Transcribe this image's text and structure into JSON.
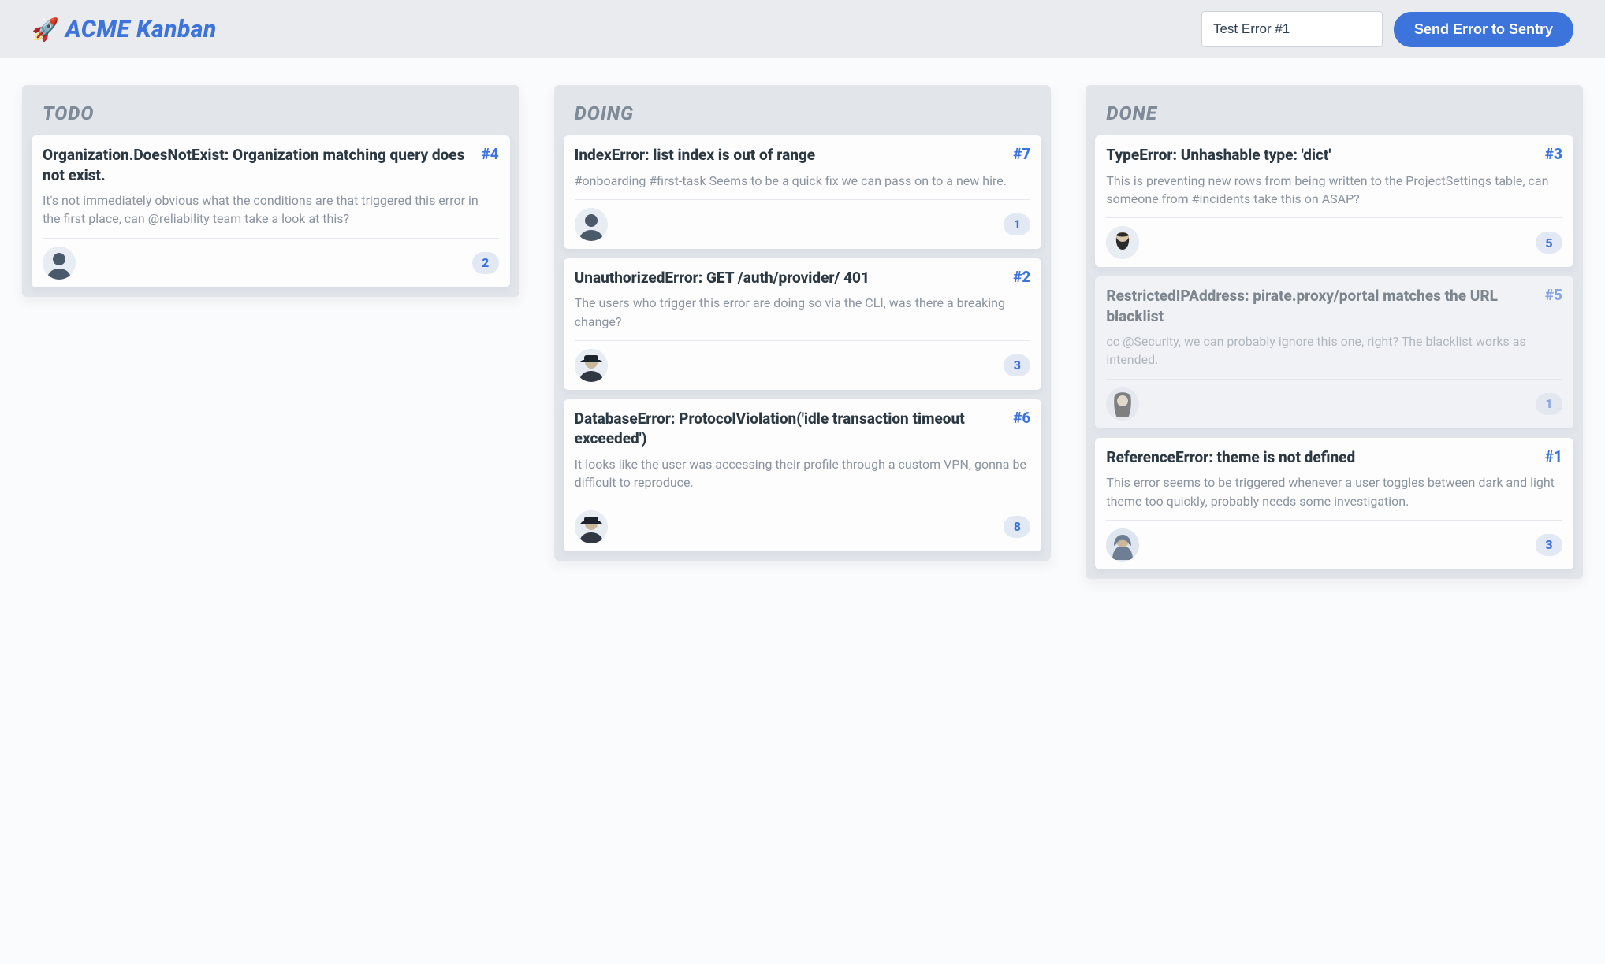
{
  "header": {
    "brand_emoji": "🚀",
    "brand_title": "ACME Kanban",
    "error_input_value": "Test Error #1",
    "send_button_label": "Send Error to Sentry"
  },
  "columns": [
    {
      "key": "todo",
      "title": "TODO",
      "cards": [
        {
          "title": "Organization.DoesNotExist: Organization matching query does not exist.",
          "number": "#4",
          "desc": "It's not immediately obvious what the conditions are that triggered this error in the first place, can @reliability team take a look at this?",
          "count": "2",
          "avatar": "user-a",
          "archived": false
        }
      ]
    },
    {
      "key": "doing",
      "title": "DOING",
      "cards": [
        {
          "title": "IndexError: list index is out of range",
          "number": "#7",
          "desc": "#onboarding #first-task Seems to be a quick fix we can pass on to a new hire.",
          "count": "1",
          "avatar": "user-a",
          "archived": false
        },
        {
          "title": "UnauthorizedError: GET /auth/provider/ 401",
          "number": "#2",
          "desc": "The users who trigger this error are doing so via the CLI, was there a breaking change?",
          "count": "3",
          "avatar": "user-cap",
          "archived": false
        },
        {
          "title": "DatabaseError: ProtocolViolation('idle transaction timeout exceeded')",
          "number": "#6",
          "desc": "It looks like the user was accessing their profile through a custom VPN, gonna be difficult to reproduce.",
          "count": "8",
          "avatar": "user-cap",
          "archived": false
        }
      ]
    },
    {
      "key": "done",
      "title": "DONE",
      "cards": [
        {
          "title": "TypeError: Unhashable type: 'dict'",
          "number": "#3",
          "desc": "This is preventing new rows from being written to the ProjectSettings table, can someone from #incidents take this on ASAP?",
          "count": "5",
          "avatar": "user-beard",
          "archived": false
        },
        {
          "title": "RestrictedIPAddress: pirate.proxy/portal matches the URL blacklist",
          "number": "#5",
          "desc": "cc @Security, we can probably ignore this one, right? The blacklist works as intended.",
          "count": "1",
          "avatar": "user-long",
          "archived": true
        },
        {
          "title": "ReferenceError: theme is not defined",
          "number": "#1",
          "desc": "This error seems to be triggered whenever a user toggles between dark and light theme too quickly, probably needs some investigation.",
          "count": "3",
          "avatar": "user-hood",
          "archived": false
        }
      ]
    }
  ]
}
